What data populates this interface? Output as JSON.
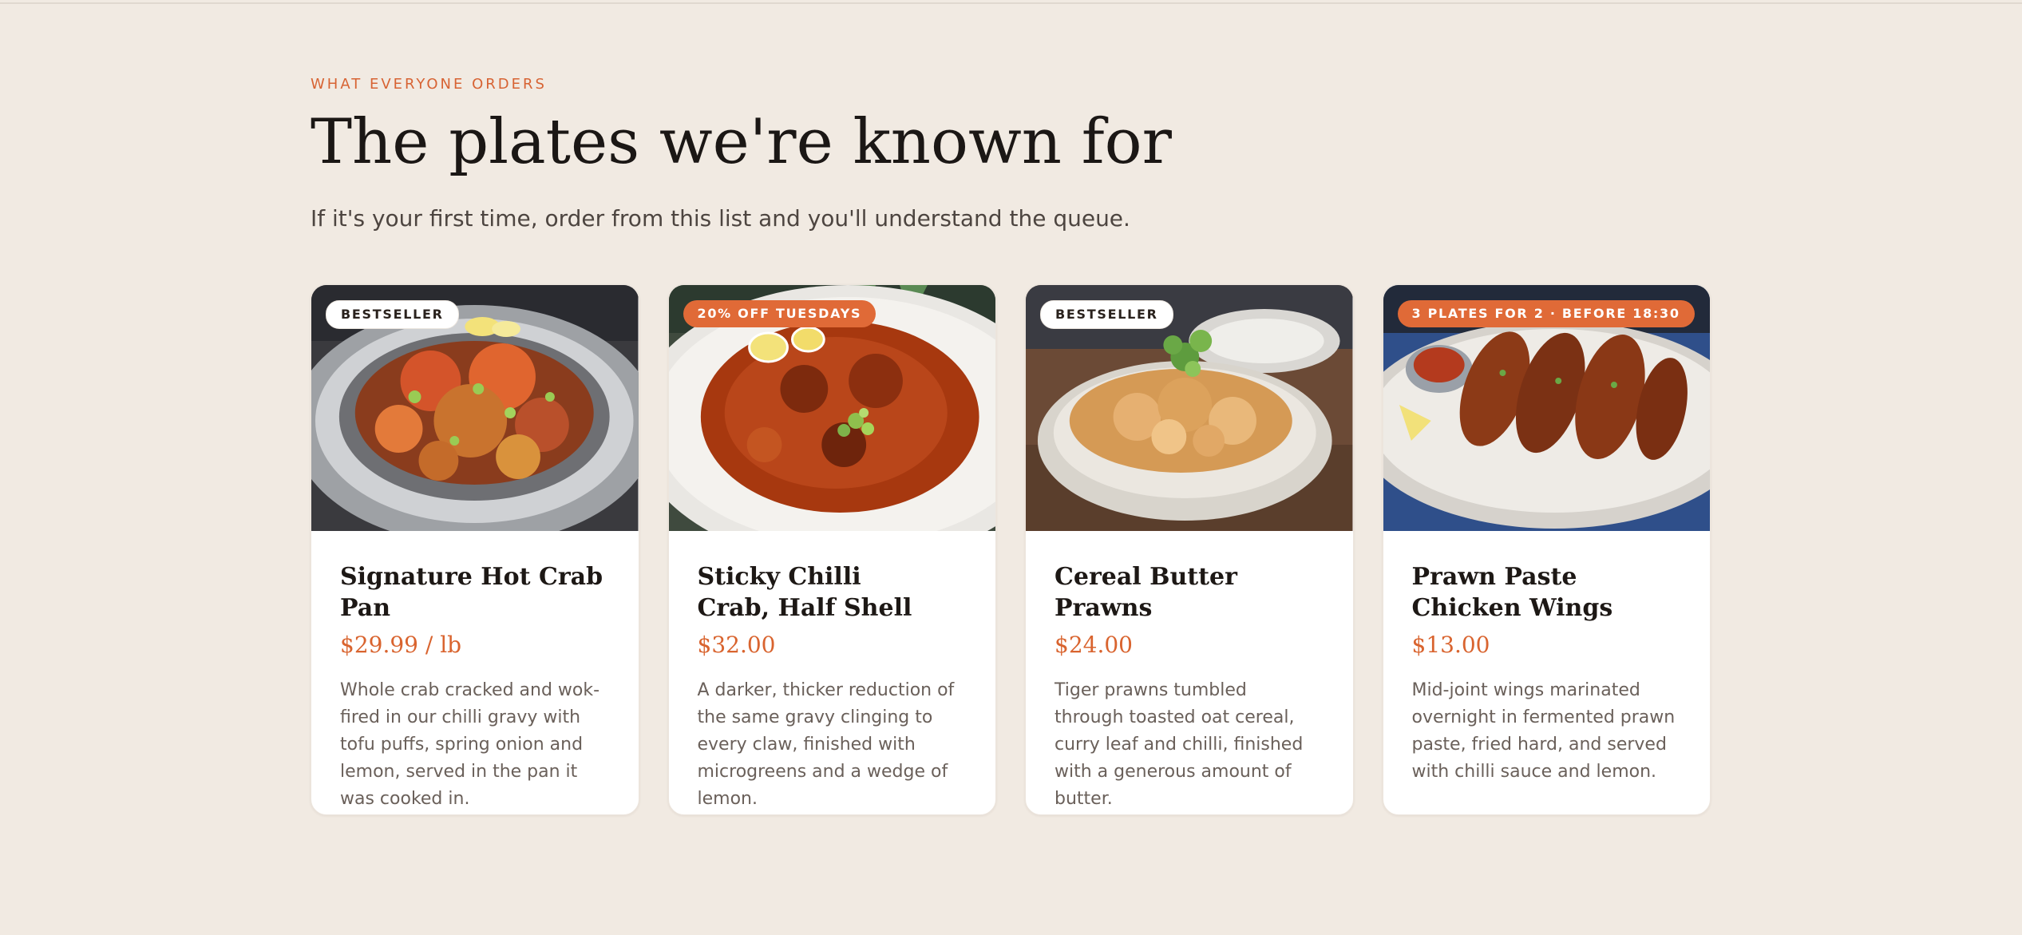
{
  "section": {
    "eyebrow": "WHAT EVERYONE ORDERS",
    "title": "The plates we're known for",
    "subtitle": "If it's your first time, order from this list and you'll understand the queue."
  },
  "colors": {
    "background": "#f1eae2",
    "accent": "#d9642f",
    "card_bg": "#ffffff",
    "body_text": "#6a605a"
  },
  "cards": [
    {
      "badge": "BESTSELLER",
      "badge_style": "light",
      "name_line1": "Signature Hot Crab Pan",
      "name_line2": "",
      "price": "$29.99 / lb",
      "description": "Whole crab cracked and wok-fired in our chilli gravy with tofu puffs, spring onion and lemon, served in the pan it was cooked in.",
      "image": "hot-crab-pan-photo"
    },
    {
      "badge": "20% OFF TUESDAYS",
      "badge_style": "accent",
      "name_line1": "Sticky Chilli",
      "name_line2": "Crab, Half Shell",
      "price": "$32.00",
      "description": "A darker, thicker reduction of the same gravy clinging to every claw, finished with microgreens and a wedge of lemon.",
      "image": "chilli-crab-photo"
    },
    {
      "badge": "BESTSELLER",
      "badge_style": "light",
      "name_line1": "Cereal Butter Prawns",
      "name_line2": "",
      "price": "$24.00",
      "description": "Tiger prawns tumbled through toasted oat cereal, curry leaf and chilli, finished with a generous amount of butter.",
      "image": "cereal-prawns-photo"
    },
    {
      "badge": "3 PLATES FOR 2 · BEFORE 18:30",
      "badge_style": "accent",
      "name_line1": "Prawn Paste",
      "name_line2": "Chicken Wings",
      "price": "$13.00",
      "description": "Mid-joint wings marinated overnight in fermented prawn paste, fried hard, and served with chilli sauce and lemon.",
      "image": "chicken-wings-photo"
    }
  ]
}
